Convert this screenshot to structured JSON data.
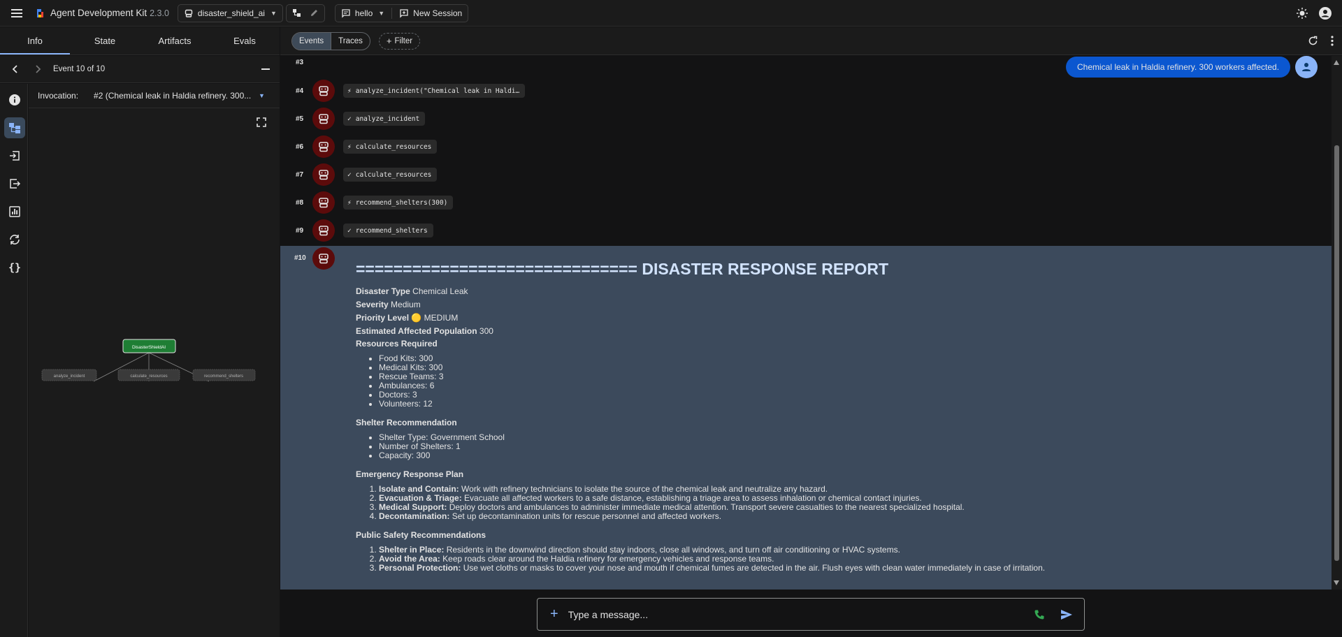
{
  "app": {
    "title": "Agent Development Kit",
    "version": "2.3.0",
    "agent_name": "disaster_shield_ai",
    "session_name": "hello",
    "new_session_label": "New Session"
  },
  "left_panel": {
    "tabs": [
      "Info",
      "State",
      "Artifacts",
      "Evals"
    ],
    "active_tab": "Info",
    "event_label": "Event 10 of 10",
    "invocation_label": "Invocation:",
    "invocation_value": "#2 (Chemical leak in Haldia refinery. 300..."
  },
  "graph": {
    "root": "DisasterShieldAI",
    "tools": [
      "analyze_incident",
      "calculate_resources",
      "recommend_shelters"
    ]
  },
  "toolbar": {
    "events_label": "Events",
    "traces_label": "Traces",
    "filter_label": "Filter"
  },
  "events": [
    {
      "num": "#3"
    },
    {
      "num": "#4",
      "kind": "call",
      "text": "analyze_incident(\"Chemical leak in Haldi…"
    },
    {
      "num": "#5",
      "kind": "result",
      "text": "analyze_incident"
    },
    {
      "num": "#6",
      "kind": "call",
      "text": "calculate_resources"
    },
    {
      "num": "#7",
      "kind": "result",
      "text": "calculate_resources"
    },
    {
      "num": "#8",
      "kind": "call",
      "text": "recommend_shelters(300)"
    },
    {
      "num": "#9",
      "kind": "result",
      "text": "recommend_shelters"
    },
    {
      "num": "#10"
    }
  ],
  "user_message": "Chemical leak in Haldia refinery. 300 workers affected.",
  "report": {
    "title": "============================== DISASTER RESPONSE REPORT",
    "fields": [
      {
        "key": "Disaster Type",
        "value": "Chemical Leak"
      },
      {
        "key": "Severity",
        "value": "Medium"
      },
      {
        "key": "Priority Level",
        "value": "🟡 MEDIUM"
      },
      {
        "key": "Estimated Affected Population",
        "value": "300"
      }
    ],
    "resources_heading": "Resources Required",
    "resources": [
      "Food Kits: 300",
      "Medical Kits: 300",
      "Rescue Teams: 3",
      "Ambulances: 6",
      "Doctors: 3",
      "Volunteers: 12"
    ],
    "shelter_heading": "Shelter Recommendation",
    "shelter": [
      "Shelter Type: Government School",
      "Number of Shelters: 1",
      "Capacity: 300"
    ],
    "plan_heading": "Emergency Response Plan",
    "plan": [
      {
        "bold": "Isolate and Contain:",
        "text": "Work with refinery technicians to isolate the source of the chemical leak and neutralize any hazard."
      },
      {
        "bold": "Evacuation & Triage:",
        "text": "Evacuate all affected workers to a safe distance, establishing a triage area to assess inhalation or chemical contact injuries."
      },
      {
        "bold": "Medical Support:",
        "text": "Deploy doctors and ambulances to administer immediate medical attention. Transport severe casualties to the nearest specialized hospital."
      },
      {
        "bold": "Decontamination:",
        "text": "Set up decontamination units for rescue personnel and affected workers."
      }
    ],
    "safety_heading": "Public Safety Recommendations",
    "safety": [
      {
        "bold": "Shelter in Place:",
        "text": "Residents in the downwind direction should stay indoors, close all windows, and turn off air conditioning or HVAC systems."
      },
      {
        "bold": "Avoid the Area:",
        "text": "Keep roads clear around the Haldia refinery for emergency vehicles and response teams."
      },
      {
        "bold": "Personal Protection:",
        "text": "Use wet cloths or masks to cover your nose and mouth if chemical fumes are detected in the air. Flush eyes with clean water immediately in case of irritation."
      }
    ]
  },
  "composer": {
    "placeholder": "Type a message..."
  },
  "colors": {
    "accent": "#8ab4f8",
    "user_bubble": "#0b57d0",
    "agent_avatar": "#5c0b0b",
    "report_bg": "#3c4a5c",
    "graph_root": "#1e7e34"
  }
}
